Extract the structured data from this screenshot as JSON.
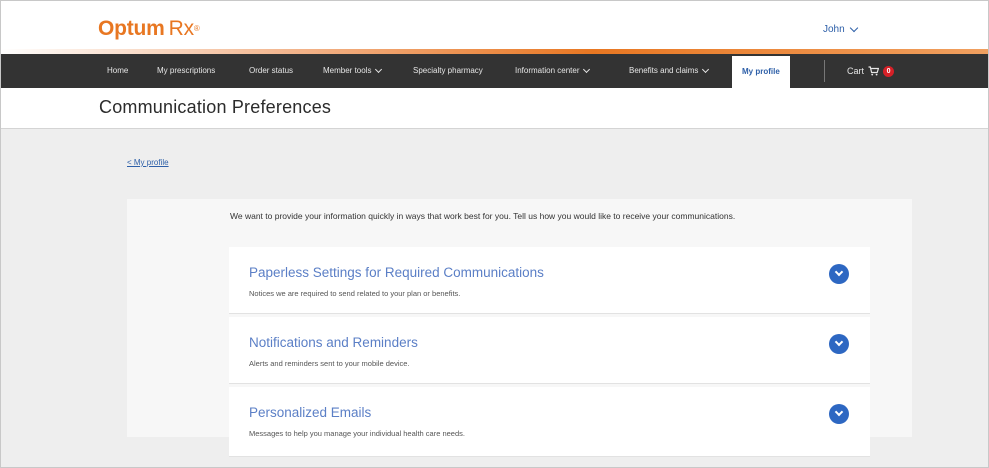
{
  "header": {
    "brand": "Optum",
    "brand_suffix": "Rx",
    "brand_mark": "®",
    "user_name": "John",
    "accent_color": "#e87722"
  },
  "nav": {
    "items": [
      {
        "label": "Home"
      },
      {
        "label": "My prescriptions"
      },
      {
        "label": "Order status"
      },
      {
        "label": "Member tools"
      },
      {
        "label": "Specialty pharmacy"
      },
      {
        "label": "Information center"
      },
      {
        "label": "Benefits and claims"
      },
      {
        "label": "My profile"
      }
    ],
    "cart_label": "Cart",
    "cart_count": "0",
    "cart_icon": "shopping-cart-icon"
  },
  "page": {
    "title": "Communication Preferences",
    "back_link": "< My profile",
    "intro": "We want to provide your information quickly in ways that work best for you. Tell us how you would like to receive your communications."
  },
  "sections": [
    {
      "title": "Paperless Settings for Required Communications",
      "description": "Notices we are required to send related to your plan or benefits."
    },
    {
      "title": "Notifications and Reminders",
      "description": "Alerts and reminders sent to your mobile device."
    },
    {
      "title": "Personalized Emails",
      "description": "Messages to help you manage your individual health care needs."
    }
  ],
  "colors": {
    "link_blue": "#2d5fa8",
    "section_title_blue": "#5b7fc6",
    "expand_button_blue": "#2d67c2",
    "nav_bg": "#333333",
    "cart_badge_red": "#d62027"
  }
}
